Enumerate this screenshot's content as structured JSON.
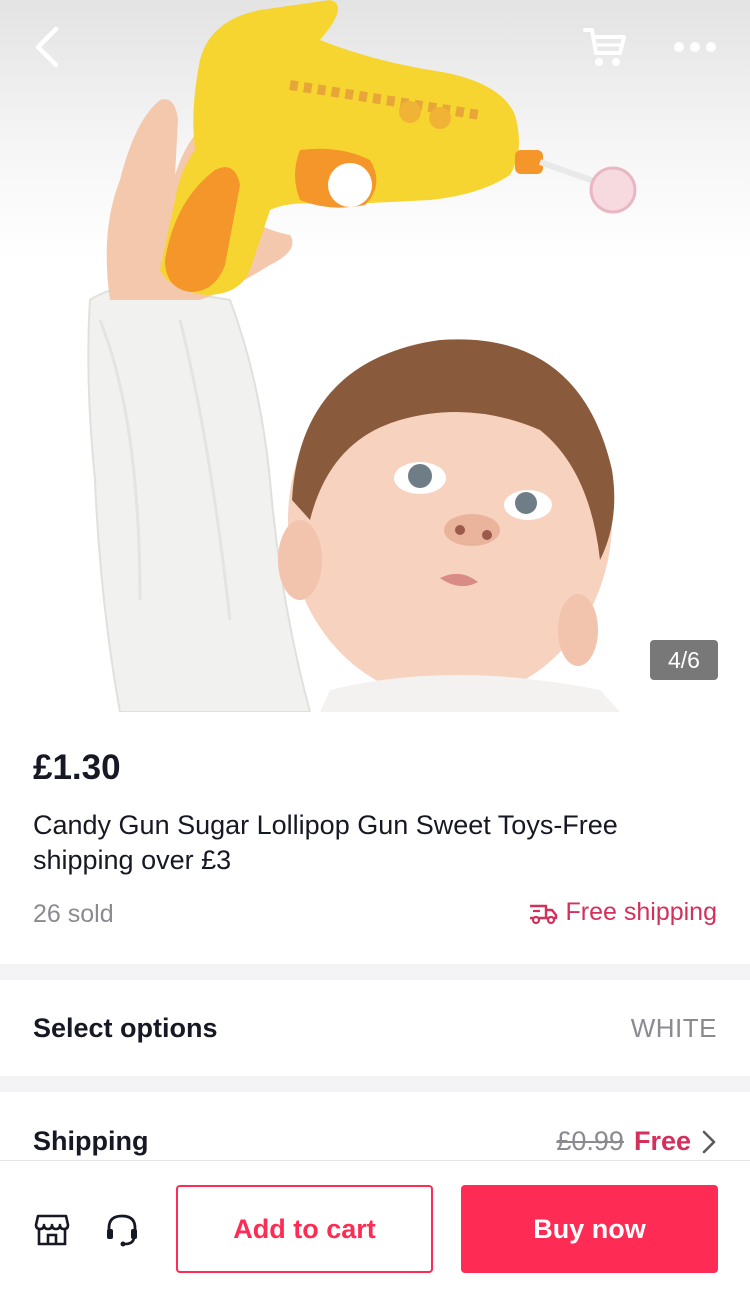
{
  "gallery": {
    "counter": "4/6",
    "image_alt": "Baby reaching for yellow candy gun toy with lollipop"
  },
  "topbar": {
    "back_icon": "chevron-left-icon",
    "cart_icon": "cart-icon",
    "more_icon": "more-dots-icon"
  },
  "product": {
    "price": "£1.30",
    "title": "Candy Gun Sugar Lollipop Gun Sweet Toys-Free shipping over £3",
    "sold": "26 sold",
    "free_shipping_label": "Free shipping"
  },
  "options": {
    "label": "Select options",
    "value": "WHITE"
  },
  "shipping": {
    "label": "Shipping",
    "old_price": "£0.99",
    "new_price": "Free"
  },
  "actions": {
    "add_to_cart": "Add to cart",
    "buy_now": "Buy now"
  },
  "colors": {
    "accent": "#fe2c55",
    "accent_text": "#d4305c",
    "muted": "#8a8b91",
    "text": "#161823"
  }
}
